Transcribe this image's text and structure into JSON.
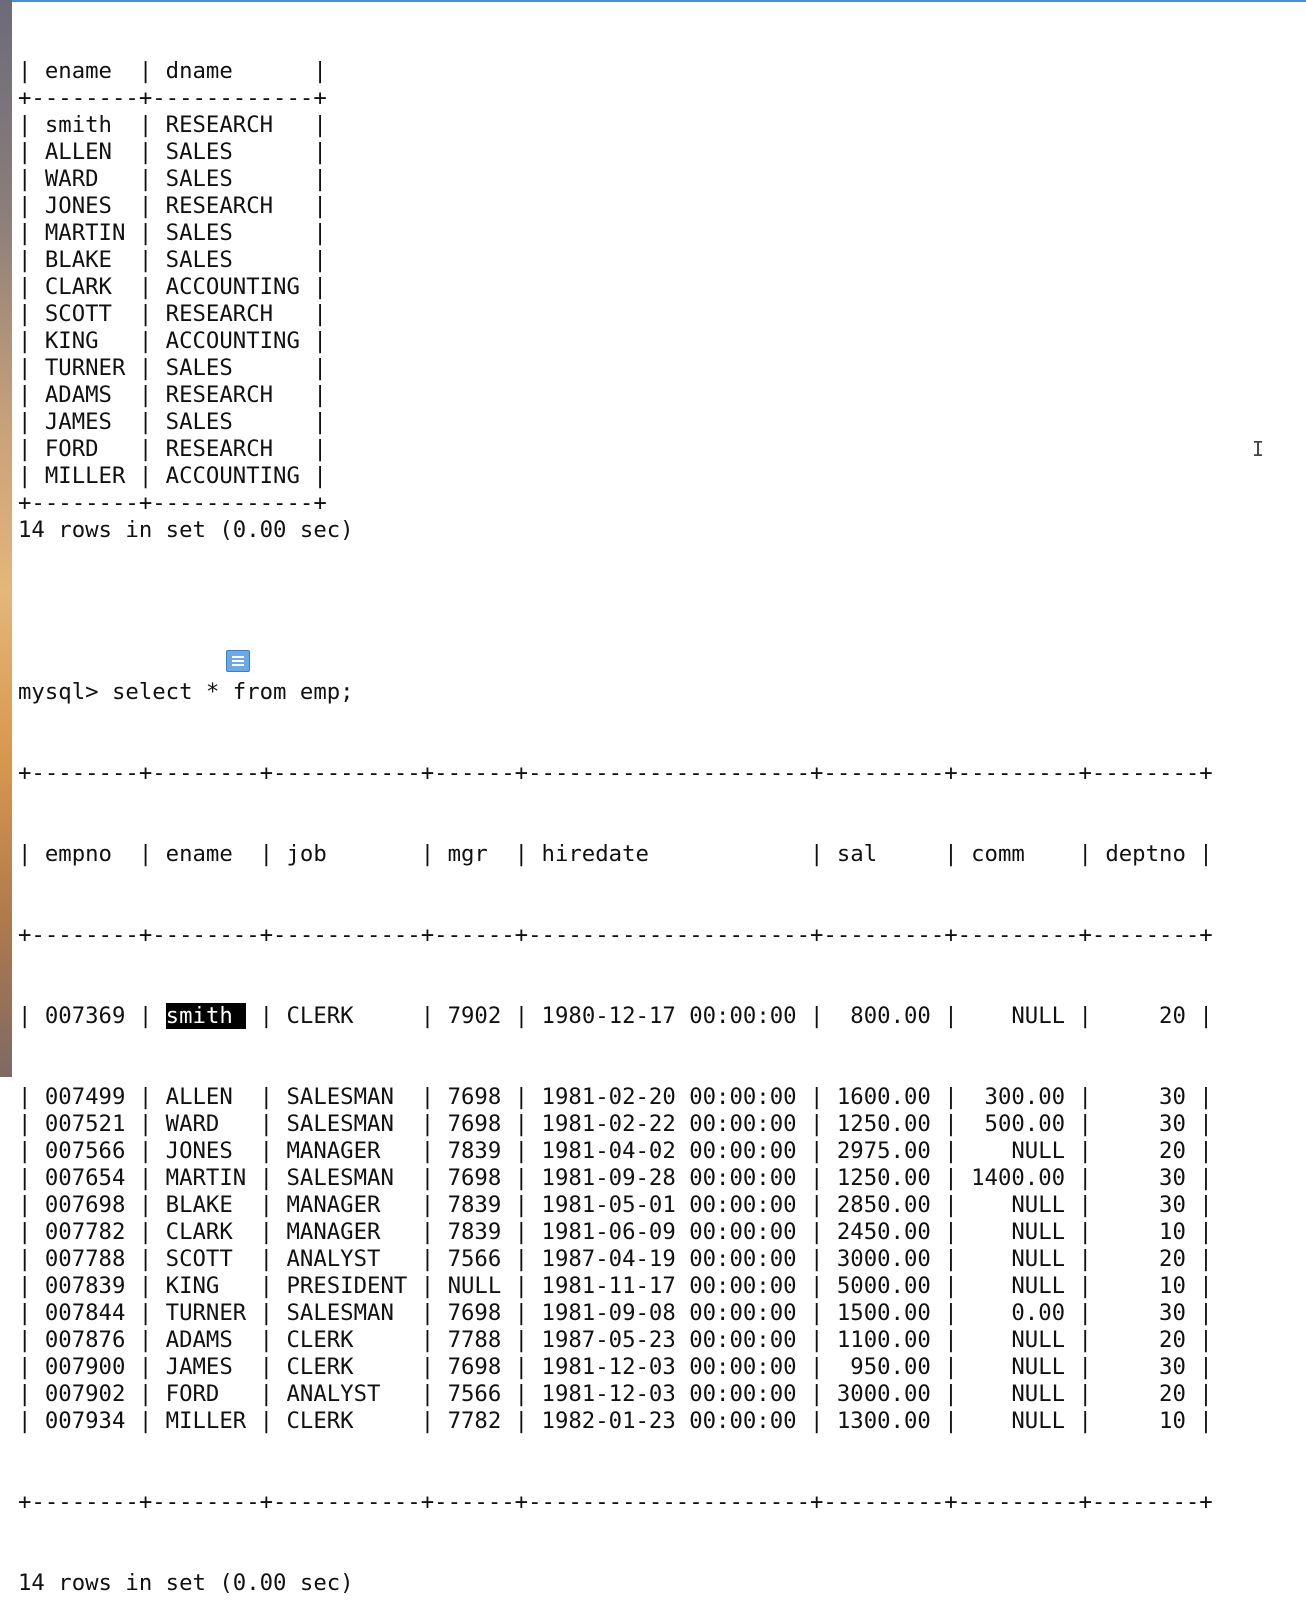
{
  "terminal": {
    "top_lines": [
      "| ename  | dname      |",
      "+--------+------------+",
      "| smith  | RESEARCH   |",
      "| ALLEN  | SALES      |",
      "| WARD   | SALES      |",
      "| JONES  | RESEARCH   |",
      "| MARTIN | SALES      |",
      "| BLAKE  | SALES      |",
      "| CLARK  | ACCOUNTING |",
      "| SCOTT  | RESEARCH   |",
      "| KING   | ACCOUNTING |",
      "| TURNER | SALES      |",
      "| ADAMS  | RESEARCH   |",
      "| JAMES  | SALES      |",
      "| FORD   | RESEARCH   |",
      "| MILLER | ACCOUNTING |",
      "+--------+------------+",
      "14 rows in set (0.00 sec)"
    ],
    "prompt_line": "mysql> select * from emp;",
    "emp_border": "+--------+--------+-----------+------+---------------------+---------+---------+--------+",
    "emp_header": "| empno  | ename  | job       | mgr  | hiredate            | sal     | comm    | deptno |",
    "emp_first_prefix": "| 007369 | ",
    "emp_first_selected": "smith ",
    "emp_first_suffix": " | CLERK     | 7902 | 1980-12-17 00:00:00 |  800.00 |    NULL |     20 |",
    "emp_rows": [
      "| 007499 | ALLEN  | SALESMAN  | 7698 | 1981-02-20 00:00:00 | 1600.00 |  300.00 |     30 |",
      "| 007521 | WARD   | SALESMAN  | 7698 | 1981-02-22 00:00:00 | 1250.00 |  500.00 |     30 |",
      "| 007566 | JONES  | MANAGER   | 7839 | 1981-04-02 00:00:00 | 2975.00 |    NULL |     20 |",
      "| 007654 | MARTIN | SALESMAN  | 7698 | 1981-09-28 00:00:00 | 1250.00 | 1400.00 |     30 |",
      "| 007698 | BLAKE  | MANAGER   | 7839 | 1981-05-01 00:00:00 | 2850.00 |    NULL |     30 |",
      "| 007782 | CLARK  | MANAGER   | 7839 | 1981-06-09 00:00:00 | 2450.00 |    NULL |     10 |",
      "| 007788 | SCOTT  | ANALYST   | 7566 | 1987-04-19 00:00:00 | 3000.00 |    NULL |     20 |",
      "| 007839 | KING   | PRESIDENT | NULL | 1981-11-17 00:00:00 | 5000.00 |    NULL |     10 |",
      "| 007844 | TURNER | SALESMAN  | 7698 | 1981-09-08 00:00:00 | 1500.00 |    0.00 |     30 |",
      "| 007876 | ADAMS  | CLERK     | 7788 | 1987-05-23 00:00:00 | 1100.00 |    NULL |     20 |",
      "| 007900 | JAMES  | CLERK     | 7698 | 1981-12-03 00:00:00 |  950.00 |    NULL |     30 |",
      "| 007902 | FORD   | ANALYST   | 7566 | 1981-12-03 00:00:00 | 3000.00 |    NULL |     20 |",
      "| 007934 | MILLER | CLERK     | 7782 | 1982-01-23 00:00:00 | 1300.00 |    NULL |     10 |"
    ],
    "emp_footer": "14 rows in set (0.00 sec)"
  }
}
